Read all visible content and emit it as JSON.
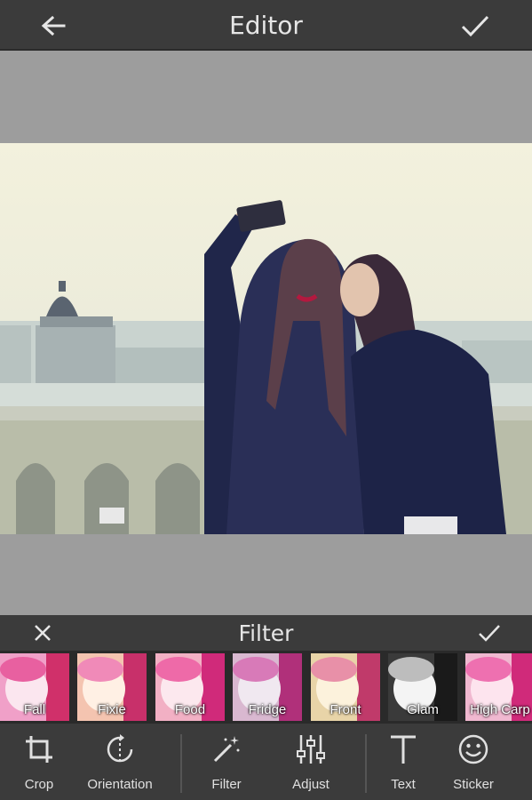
{
  "header": {
    "title": "Editor",
    "back_icon": "arrow-left-icon",
    "done_icon": "check-icon"
  },
  "filter_panel": {
    "title": "Filter",
    "cancel_icon": "close-icon",
    "apply_icon": "check-icon",
    "filters": [
      {
        "label": "Fall",
        "tint": "#f0a0c8"
      },
      {
        "label": "Fixie",
        "tint": "#f4c4b0"
      },
      {
        "label": "Food",
        "tint": "#f2b0c4"
      },
      {
        "label": "Fridge",
        "tint": "#d9b8d0"
      },
      {
        "label": "Front",
        "tint": "#e8d4a8"
      },
      {
        "label": "Glam",
        "tint": "#d8d8d8"
      },
      {
        "label": "High Carp",
        "tint": "#f0b8d0"
      }
    ]
  },
  "toolbar": {
    "items": [
      {
        "label": "Crop",
        "icon": "crop-icon"
      },
      {
        "label": "Orientation",
        "icon": "rotate-icon"
      },
      {
        "label": "Filter",
        "icon": "magic-wand-icon"
      },
      {
        "label": "Adjust",
        "icon": "sliders-icon"
      },
      {
        "label": "Text",
        "icon": "text-icon"
      },
      {
        "label": "Sticker",
        "icon": "smiley-icon"
      }
    ]
  }
}
